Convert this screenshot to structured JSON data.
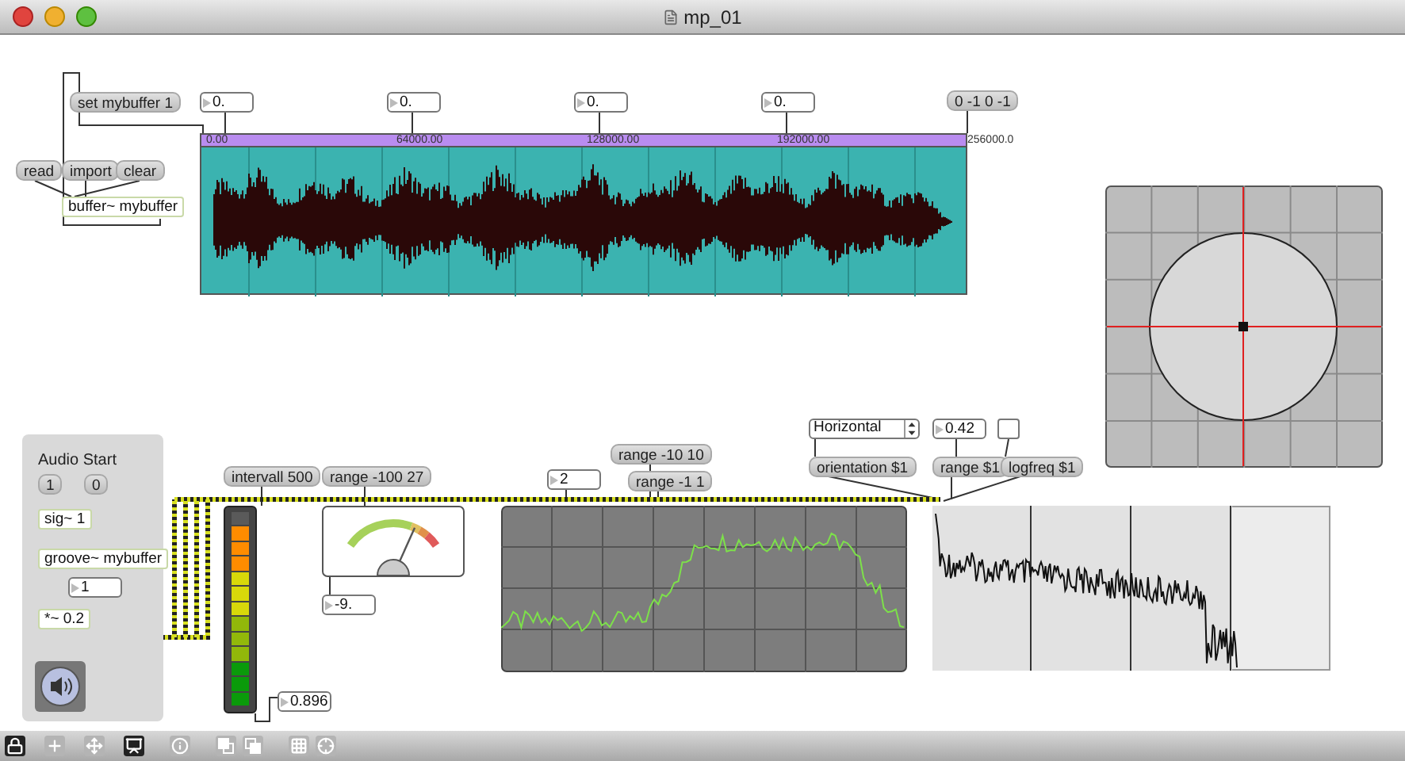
{
  "window": {
    "title": "mp_01"
  },
  "messages": [
    {
      "text": "set mybuffer 1"
    },
    {
      "text": "read"
    },
    {
      "text": "import"
    },
    {
      "text": "clear"
    },
    {
      "text": "0 -1 0 -1"
    },
    {
      "text": "1"
    },
    {
      "text": "0"
    },
    {
      "text": "intervall 500"
    },
    {
      "text": "range -100 27"
    },
    {
      "text": "range -10 10"
    },
    {
      "text": "range -1 1"
    },
    {
      "text": "orientation $1"
    },
    {
      "text": "range $1"
    },
    {
      "text": "logfreq $1"
    }
  ],
  "objects": [
    "buffer~ mybuffer",
    "sig~ 1",
    "groove~ mybuffer",
    "*~ 0.2"
  ],
  "number_boxes": [
    "0.",
    "0.",
    "0.",
    "0.",
    "1",
    "0.896",
    "-9.",
    "2",
    "0.42"
  ],
  "comment": "Audio Start",
  "waveform": {
    "ruler": [
      "0.00",
      "64000.00",
      "128000.00",
      "192000.00",
      "256000.0"
    ]
  },
  "meter": {
    "level": 0.92
  },
  "dial_meter": {
    "level": 0.72
  },
  "menu": {
    "value": "Horizontal"
  },
  "toggle": {
    "checked": false
  },
  "toolbar": [
    {
      "kind": "lock",
      "on": true
    },
    {
      "kind": "add",
      "on": false
    },
    {
      "kind": "move",
      "on": false
    },
    {
      "kind": "presentation",
      "on": true
    },
    {
      "kind": "info",
      "on": false
    },
    {
      "kind": "front",
      "on": false
    },
    {
      "kind": "back",
      "on": false
    },
    {
      "kind": "grid",
      "on": false
    },
    {
      "kind": "snap",
      "on": false
    }
  ]
}
